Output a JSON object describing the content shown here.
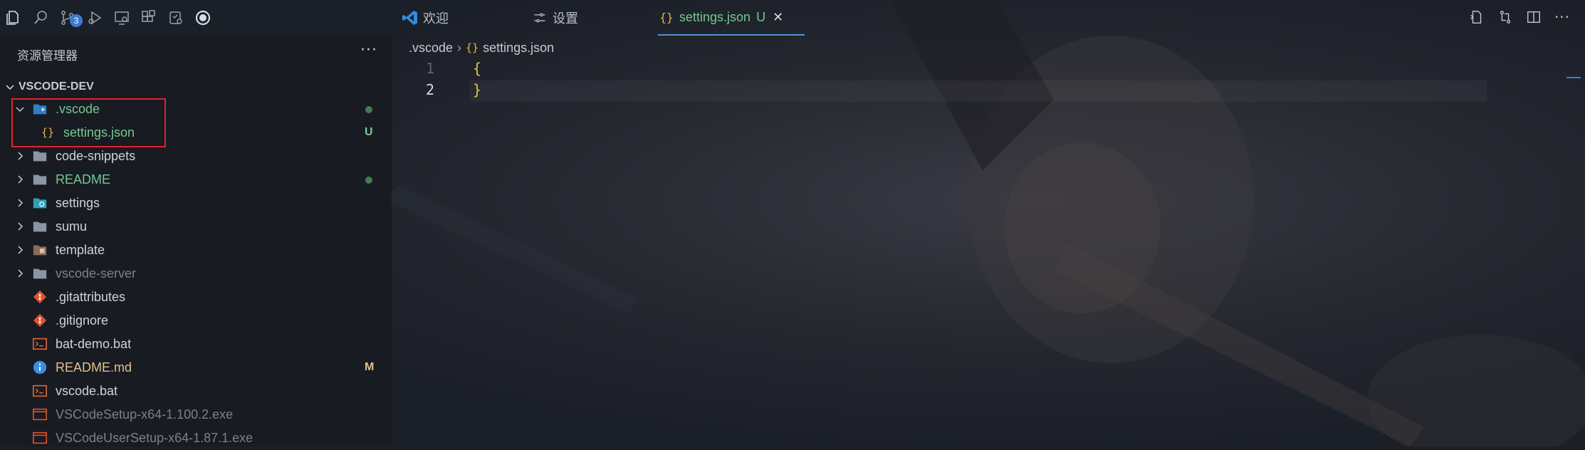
{
  "activity_bar": {
    "scm_badge": "3"
  },
  "sidebar": {
    "title": "资源管理器",
    "more": "···",
    "section": "VSCODE-DEV",
    "items": [
      {
        "label": ".vscode",
        "icon": "vscode-folder-icon",
        "color": "#73c991",
        "status": "",
        "dot": true,
        "expanded": true
      },
      {
        "label": "settings.json",
        "icon": "json-braces-icon",
        "color": "#73c991",
        "status": "U",
        "dot": false
      },
      {
        "label": "code-snippets",
        "icon": "folder-icon",
        "color": "#cdd3de",
        "status": "",
        "dot": false
      },
      {
        "label": "README",
        "icon": "folder-icon",
        "color": "#73c991",
        "status": "",
        "dot": true
      },
      {
        "label": "settings",
        "icon": "settings-folder-icon",
        "color": "#cdd3de",
        "status": "",
        "dot": false
      },
      {
        "label": "sumu",
        "icon": "folder-icon",
        "color": "#cdd3de",
        "status": "",
        "dot": false
      },
      {
        "label": "template",
        "icon": "template-folder-icon",
        "color": "#cdd3de",
        "status": "",
        "dot": false
      },
      {
        "label": "vscode-server",
        "icon": "folder-icon",
        "color": "#7a808b",
        "status": "",
        "dot": false
      },
      {
        "label": ".gitattributes",
        "icon": "git-icon",
        "color": "#cdd3de",
        "status": "",
        "dot": false
      },
      {
        "label": ".gitignore",
        "icon": "git-icon",
        "color": "#cdd3de",
        "status": "",
        "dot": false
      },
      {
        "label": "bat-demo.bat",
        "icon": "terminal-icon",
        "color": "#cdd3de",
        "status": "",
        "dot": false
      },
      {
        "label": "README.md",
        "icon": "info-icon",
        "color": "#e2c08d",
        "status": "M",
        "dot": false
      },
      {
        "label": "vscode.bat",
        "icon": "terminal-icon",
        "color": "#cdd3de",
        "status": "",
        "dot": false
      },
      {
        "label": "VSCodeSetup-x64-1.100.2.exe",
        "icon": "exe-icon",
        "color": "#7a808b",
        "status": "",
        "dot": false
      },
      {
        "label": "VSCodeUserSetup-x64-1.87.1.exe",
        "icon": "exe-icon",
        "color": "#7a808b",
        "status": "",
        "dot": false
      }
    ]
  },
  "tabs": [
    {
      "label": "欢迎",
      "icon": "vscode-logo-icon"
    },
    {
      "label": "设置",
      "icon": "settings-sliders-icon"
    },
    {
      "label": "settings.json",
      "status": "U",
      "icon": "json-braces-icon",
      "active": true,
      "close": "✕"
    }
  ],
  "breadcrumb": {
    "folder": ".vscode",
    "file": "settings.json"
  },
  "editor": {
    "lines": [
      {
        "number": "1",
        "text": "{"
      },
      {
        "number": "2",
        "text": "}"
      }
    ]
  }
}
